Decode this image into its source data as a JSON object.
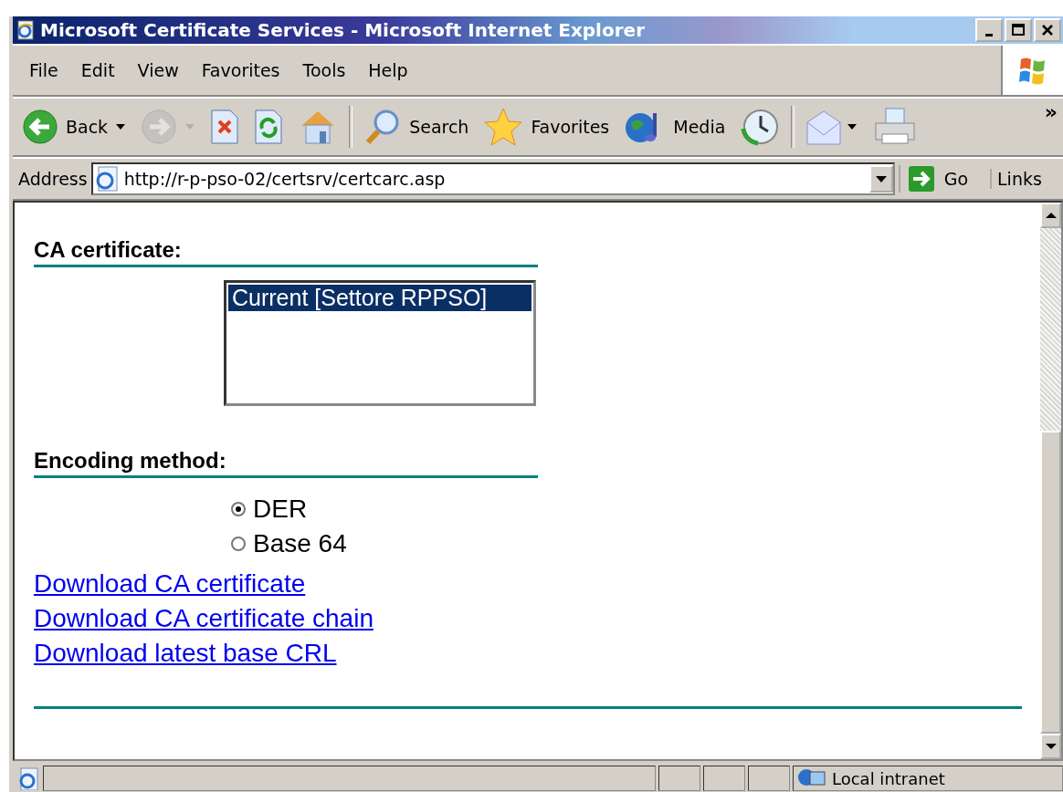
{
  "window": {
    "title": "Microsoft Certificate Services - Microsoft Internet Explorer"
  },
  "menu": [
    "File",
    "Edit",
    "View",
    "Favorites",
    "Tools",
    "Help"
  ],
  "toolbar": [
    {
      "kind": "back",
      "label": "Back",
      "disabled": false
    },
    {
      "kind": "forward",
      "disabled": true
    },
    {
      "kind": "stop",
      "disabled": false
    },
    {
      "kind": "refresh",
      "disabled": false
    },
    {
      "kind": "home",
      "disabled": false
    },
    {
      "kind": "search",
      "label": "Search",
      "disabled": false
    },
    {
      "kind": "favorites",
      "label": "Favorites",
      "disabled": false
    },
    {
      "kind": "media",
      "label": "Media",
      "disabled": false
    },
    {
      "kind": "history",
      "disabled": false
    },
    {
      "kind": "mail",
      "disabled": false
    },
    {
      "kind": "print",
      "disabled": false
    }
  ],
  "toolbar_more": "»",
  "address_bar": {
    "label": "Address",
    "value": "http://r-p-pso-02/certsrv/certcarc.asp",
    "go": "Go",
    "links": "Links"
  },
  "sections": [
    {
      "heading": "CA certificate:",
      "kind": "listbox",
      "options": [
        {
          "label": "Current [Settore RPPSO]",
          "selected": true
        }
      ]
    },
    {
      "heading": "Encoding method:",
      "kind": "radio",
      "options": [
        {
          "label": "DER",
          "selected": true
        },
        {
          "label": "Base 64",
          "selected": false
        }
      ]
    }
  ],
  "links": [
    "Download CA certificate",
    "Download CA certificate chain",
    "Download latest base CRL"
  ],
  "status_bar": {
    "zone": "Local intranet"
  }
}
